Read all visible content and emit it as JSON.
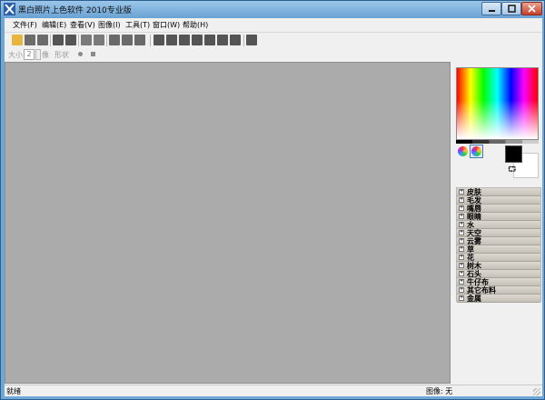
{
  "window": {
    "title": "黑白照片上色软件 2010专业版"
  },
  "menu": [
    {
      "label": "文件(F)"
    },
    {
      "label": "编辑(E)"
    },
    {
      "label": "查看(V)"
    },
    {
      "label": "图像(I)"
    },
    {
      "label": "工具(T)"
    },
    {
      "label": "窗口(W)"
    },
    {
      "label": "帮助(H)"
    }
  ],
  "toolbar": {
    "tools": [
      {
        "icon": "open-icon",
        "color": "#e8b63c"
      },
      {
        "icon": "save-icon",
        "color": "#6b6b6b"
      },
      {
        "icon": "print-icon",
        "color": "#6b6b6b"
      },
      {
        "icon": "undo-icon",
        "color": "#555555"
      },
      {
        "icon": "redo-icon",
        "color": "#555555"
      },
      {
        "icon": "copy-icon",
        "color": "#7a7a7a"
      },
      {
        "icon": "paste-icon",
        "color": "#7a7a7a"
      },
      {
        "icon": "layer-icon",
        "color": "#6a6a6a"
      },
      {
        "icon": "image-icon",
        "color": "#6a6a6a"
      },
      {
        "icon": "adjust-icon",
        "color": "#6a6a6a"
      },
      {
        "icon": "pencil-icon",
        "color": "#555555"
      },
      {
        "icon": "brush-icon",
        "color": "#555555"
      },
      {
        "icon": "eraser-icon",
        "color": "#555555"
      },
      {
        "icon": "eyedropper-icon",
        "color": "#555555"
      },
      {
        "icon": "rectangle-icon",
        "color": "#555555"
      },
      {
        "icon": "zoom-icon",
        "color": "#555555"
      },
      {
        "icon": "hand-icon",
        "color": "#555555"
      },
      {
        "icon": "fill-icon",
        "color": "#555555"
      }
    ]
  },
  "brush_options": {
    "size_label": "大小",
    "size_value": "2",
    "spin_label": "像",
    "shape_label": "形状"
  },
  "color_panel": {
    "foreground": "#000000",
    "background": "#ffffff",
    "swap_glyph": "⮔"
  },
  "categories": [
    {
      "label": "皮肤"
    },
    {
      "label": "毛发"
    },
    {
      "label": "嘴唇"
    },
    {
      "label": "眼睛"
    },
    {
      "label": "水"
    },
    {
      "label": "天空"
    },
    {
      "label": "云雾"
    },
    {
      "label": "草"
    },
    {
      "label": "花"
    },
    {
      "label": "树木"
    },
    {
      "label": "石头"
    },
    {
      "label": "牛仔布"
    },
    {
      "label": "其它布料"
    },
    {
      "label": "金属"
    }
  ],
  "status": {
    "left": "就绪",
    "right": "图像: 无"
  }
}
